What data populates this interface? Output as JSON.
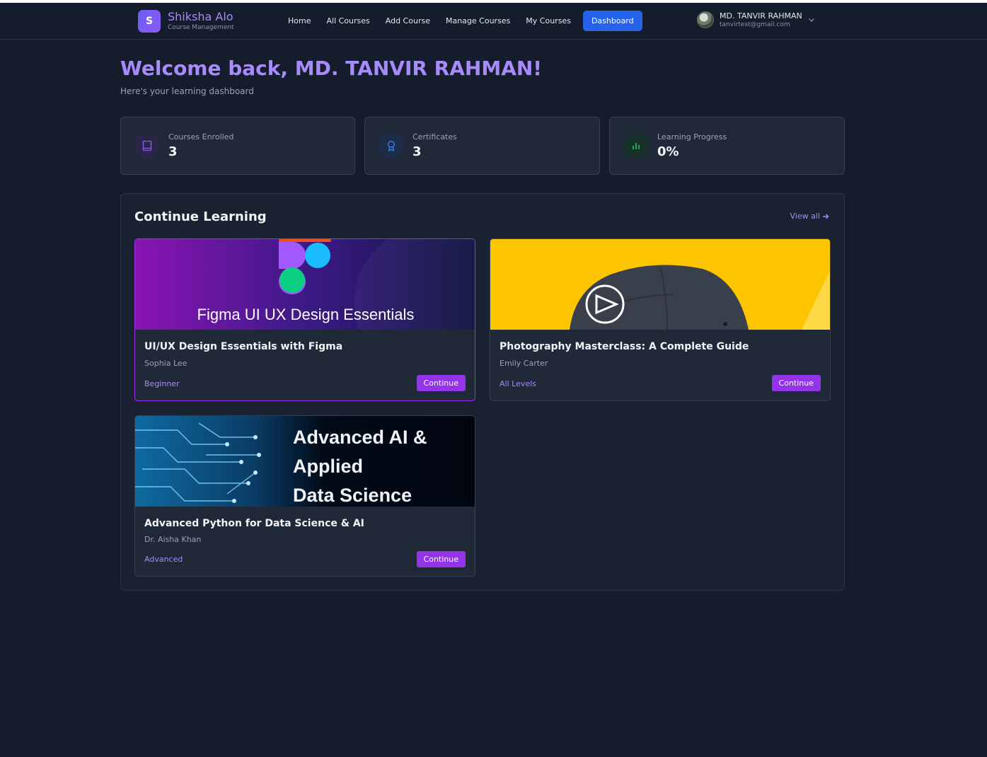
{
  "brand": {
    "badge": "S",
    "name": "Shiksha Alo",
    "subtitle": "Course Management"
  },
  "nav": {
    "items": [
      "Home",
      "All Courses",
      "Add Course",
      "Manage Courses",
      "My Courses"
    ],
    "active": "Dashboard"
  },
  "user": {
    "name": "MD. TANVIR RAHMAN",
    "email": "tanvirtest@gmail.com"
  },
  "welcome": {
    "title": "Welcome back, MD. TANVIR RAHMAN!",
    "subtitle": "Here's your learning dashboard"
  },
  "stats": [
    {
      "label": "Courses Enrolled",
      "value": "3",
      "icon": "book-icon",
      "color": "#8b5cf6"
    },
    {
      "label": "Certificates",
      "value": "3",
      "icon": "award-icon",
      "color": "#3b82f6"
    },
    {
      "label": "Learning Progress",
      "value": "0%",
      "icon": "bar-chart-icon",
      "color": "#22c55e"
    }
  ],
  "continue_learning": {
    "title": "Continue Learning",
    "view_all": "View all",
    "courses": [
      {
        "title": "UI/UX Design Essentials with Figma",
        "instructor": "Sophia Lee",
        "level": "Beginner",
        "button": "Continue",
        "thumb_text": "Figma UI UX Design Essentials"
      },
      {
        "title": "Photography Masterclass: A Complete Guide",
        "instructor": "Emily Carter",
        "level": "All Levels",
        "button": "Continue"
      },
      {
        "title": "Advanced Python for Data Science & AI",
        "instructor": "Dr. Aisha Khan",
        "level": "Advanced",
        "button": "Continue",
        "thumb_lines": [
          "Advanced AI &",
          "Applied",
          "Data Science"
        ]
      }
    ]
  },
  "colors": {
    "accent": "#a78bfa",
    "primary_button": "#9333ea",
    "nav_active": "#2563eb",
    "background": "#151c2c"
  }
}
